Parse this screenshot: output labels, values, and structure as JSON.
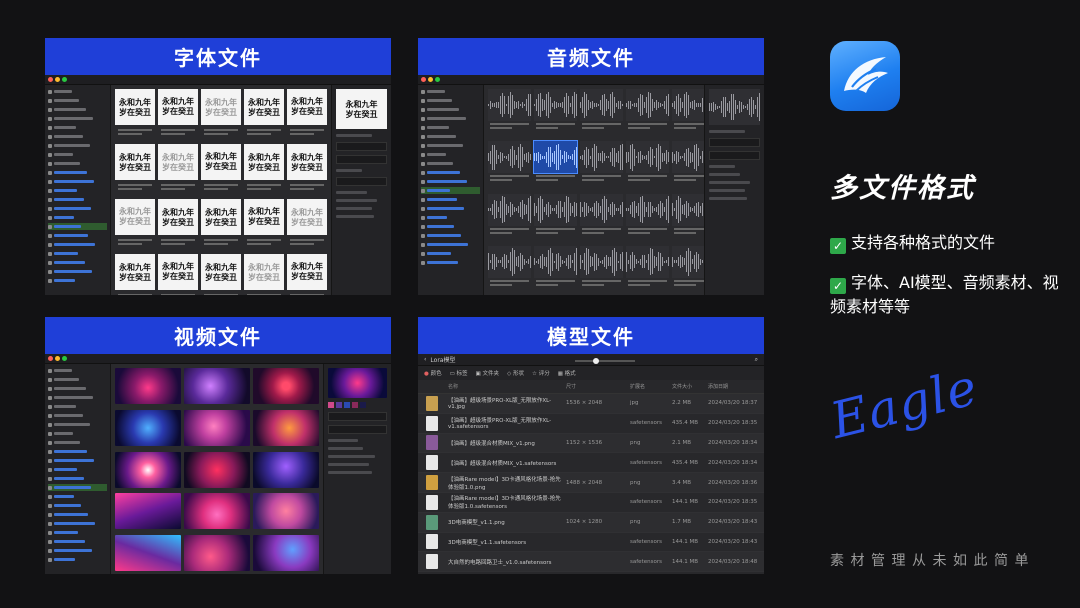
{
  "panels": {
    "font": {
      "title": "字体文件"
    },
    "audio": {
      "title": "音频文件"
    },
    "video": {
      "title": "视频文件"
    },
    "model": {
      "title": "模型文件"
    }
  },
  "font_panel": {
    "card_text": "永和九年\n岁在癸丑",
    "preview_text": "永和九年\n岁在癸丑"
  },
  "model_panel": {
    "folder": "Lora模型",
    "toolbar": [
      "颜色",
      "标签",
      "文件夹",
      "形状",
      "评分",
      "格式"
    ],
    "columns": [
      "名称",
      "尺寸",
      "扩展名",
      "文件大小",
      "添加日期"
    ],
    "rows": [
      {
        "name": "【油画】超级场景PRO-XL版_无限放作XL-v1.jpg",
        "dim": "1536 × 2048",
        "ext": "jpg",
        "size": "2.2 MB",
        "date": "2024/03/20 18:37",
        "thumb": "#c8a050"
      },
      {
        "name": "【油画】超级场景PRO-XL版_无限放作XL-v1.safetensors",
        "dim": "",
        "ext": "safetensors",
        "size": "435.4 MB",
        "date": "2024/03/20 18:35",
        "thumb": "#e8e8e8"
      },
      {
        "name": "【油画】超级混合材质MIX_v1.png",
        "dim": "1152 × 1536",
        "ext": "png",
        "size": "2.1 MB",
        "date": "2024/03/20 18:34",
        "thumb": "#8a5a9a"
      },
      {
        "name": "【油画】超级混合材质MIX_v1.safetensors",
        "dim": "",
        "ext": "safetensors",
        "size": "435.4 MB",
        "date": "2024/03/20 18:34",
        "thumb": "#e8e8e8"
      },
      {
        "name": "【油画Rare model】3D卡通风格化场景-抢先体验版1.0.png",
        "dim": "1488 × 2048",
        "ext": "png",
        "size": "3.4 MB",
        "date": "2024/03/20 18:36",
        "thumb": "#d0a040"
      },
      {
        "name": "【油画Rare model】3D卡通风格化场景-抢先体验版1.0.safetensors",
        "dim": "",
        "ext": "safetensors",
        "size": "144.1 MB",
        "date": "2024/03/20 18:35",
        "thumb": "#e8e8e8"
      },
      {
        "name": "3D电商模型_v1.1.png",
        "dim": "1024 × 1280",
        "ext": "png",
        "size": "1.7 MB",
        "date": "2024/03/20 18:43",
        "thumb": "#5a9a7a"
      },
      {
        "name": "3D电商模型_v1.1.safetensors",
        "dim": "",
        "ext": "safetensors",
        "size": "144.1 MB",
        "date": "2024/03/20 18:43",
        "thumb": "#e8e8e8"
      },
      {
        "name": "大自然的电路回路卫士_v1.0.safetensors",
        "dim": "",
        "ext": "safetensors",
        "size": "144.1 MB",
        "date": "2024/03/20 18:48",
        "thumb": "#e8e8e8"
      }
    ]
  },
  "right": {
    "headline": "多文件格式",
    "bullet1": "支持各种格式的文件",
    "bullet2": "字体、AI模型、音频素材、视频素材等等",
    "script": "Eagle",
    "tagline": "素材管理从未如此简单"
  },
  "colors": {
    "banner": "#1f3fd8",
    "accent": "#2b52e6",
    "check": "#2ea84a"
  },
  "icons": [
    "eagle-logo-icon",
    "check-icon"
  ]
}
